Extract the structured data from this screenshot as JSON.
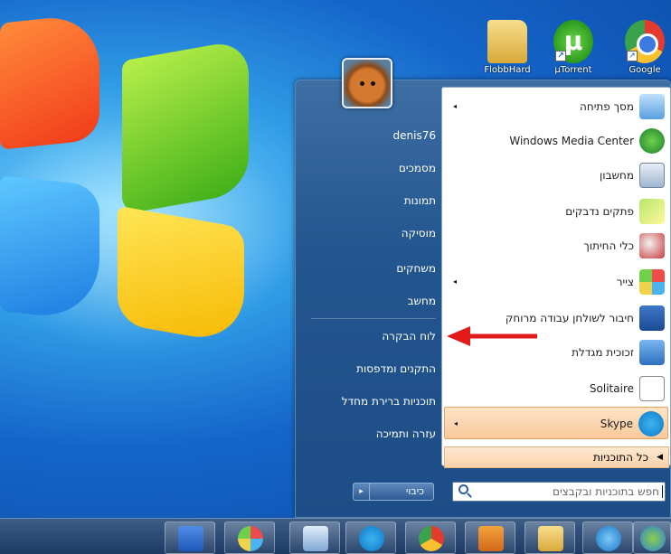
{
  "desktop": {
    "icons": [
      {
        "label": "FlobbHard",
        "icon": "folder-icon"
      },
      {
        "label": "μTorrent",
        "icon": "utorrent-icon",
        "glyph": "μ"
      },
      {
        "label": "Google",
        "icon": "chrome-icon"
      }
    ]
  },
  "start_menu": {
    "user": "denis76",
    "right_items": [
      "מסמכים",
      "תמונות",
      "מוסיקה",
      "משחקים",
      "מחשב",
      "לוח הבקרה",
      "התקנים ומדפסות",
      "תוכניות ברירת מחדל",
      "עזרה ותמיכה"
    ],
    "programs": [
      {
        "name": "מסך פתיחה",
        "submenu": true,
        "icon": "welcome-screen-icon"
      },
      {
        "name": "Windows Media Center",
        "submenu": false,
        "icon": "media-center-icon"
      },
      {
        "name": "מחשבון",
        "submenu": false,
        "icon": "calculator-icon"
      },
      {
        "name": "פתקים נדבקים",
        "submenu": false,
        "icon": "sticky-notes-icon"
      },
      {
        "name": "כלי החיתוך",
        "submenu": false,
        "icon": "snipping-tool-icon"
      },
      {
        "name": "צייר",
        "submenu": true,
        "icon": "paint-icon"
      },
      {
        "name": "חיבור לשולחן עבודה מרוחק",
        "submenu": false,
        "icon": "remote-desktop-icon"
      },
      {
        "name": "זכוכית מגדלת",
        "submenu": false,
        "icon": "magnifier-icon"
      },
      {
        "name": "Solitaire",
        "submenu": false,
        "icon": "solitaire-icon"
      },
      {
        "name": "Skype",
        "submenu": true,
        "icon": "skype-icon",
        "highlighted": true
      }
    ],
    "all_programs": "כל התוכניות",
    "search_placeholder": "חפש בתוכניות ובקבצים",
    "shutdown_label": "כיבוי",
    "submenu_arrow": "◂",
    "all_programs_arrow": "◀",
    "shutdown_arrow": "▸"
  },
  "taskbar": {
    "buttons": [
      "word-icon",
      "paint-icon",
      "control-panel-icon",
      "skype-icon",
      "chrome-icon",
      "media-icon",
      "folder-icon",
      "ie-icon",
      "start-orb-icon"
    ]
  },
  "colors": {
    "highlight": "#f9c99a",
    "arrow_red": "#e31a1a",
    "menu_blue": "#23558e"
  }
}
